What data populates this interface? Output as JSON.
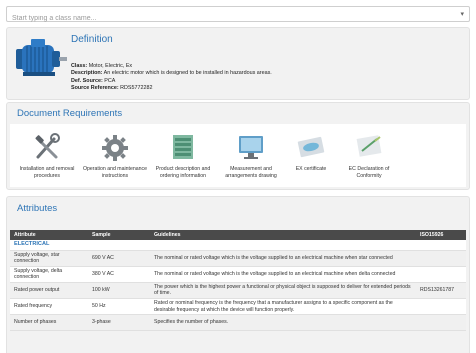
{
  "search": {
    "placeholder": "Start typing a class name..."
  },
  "definition": {
    "title": "Definition",
    "image": "electric-motor-image",
    "class_label": "Class:",
    "class_value": "Motor, Electric, Ex",
    "description_label": "Description:",
    "description_value": "An electric motor which is designed to be installed in hazardous areas.",
    "def_source_label": "Def. Source:",
    "def_source_value": "PCA",
    "source_ref_label": "Source Reference:",
    "source_ref_value": "RDS5772282"
  },
  "document_requirements": {
    "title": "Document Requirements",
    "items": [
      {
        "icon": "tools-icon",
        "label": "Installation and removal procedures"
      },
      {
        "icon": "gear-icon",
        "label": "Operation and maintenance instructions"
      },
      {
        "icon": "product-document-icon",
        "label": "Product description and ordering information"
      },
      {
        "icon": "drawing-monitor-icon",
        "label": "Measurement and arrangements drawing"
      },
      {
        "icon": "certificate-icon",
        "label": "EX certificate"
      },
      {
        "icon": "declaration-document-icon",
        "label": "EC Declaration of Conformity"
      }
    ]
  },
  "attributes": {
    "title": "Attributes",
    "headers": [
      "Attribute",
      "Sample",
      "Guidelines",
      "ISO15926"
    ],
    "category": "ELECTRICAL",
    "rows": [
      {
        "attribute": "Supply voltage, star connection",
        "sample": "690 V AC",
        "guidelines": "The nominal or rated voltage which is the voltage supplied to an electrical machine when star connected",
        "iso": ""
      },
      {
        "attribute": "Supply voltage, delta connection",
        "sample": "380 V AC",
        "guidelines": "The nominal or rated voltage which is the voltage supplied to an electrical machine when delta connected",
        "iso": ""
      },
      {
        "attribute": "Rated power output",
        "sample": "100 kW",
        "guidelines": "The power which is the highest power a functional or physical object is supposed to deliver for extended periods of time.",
        "iso": "RDS13261787"
      },
      {
        "attribute": "Rated frequency",
        "sample": "50 Hz",
        "guidelines": "Rated or nominal frequency is the frequency that a manufacturer assigns to a specific component as the desirable frequency at which the device will function properly.",
        "iso": ""
      },
      {
        "attribute": "Number of phases",
        "sample": "3-phase",
        "guidelines": "Specifies the number of phases.",
        "iso": ""
      }
    ]
  },
  "colors": {
    "accent": "#2e75b6",
    "panel": "#f2f2f2",
    "table_header": "#4a4a4a"
  }
}
